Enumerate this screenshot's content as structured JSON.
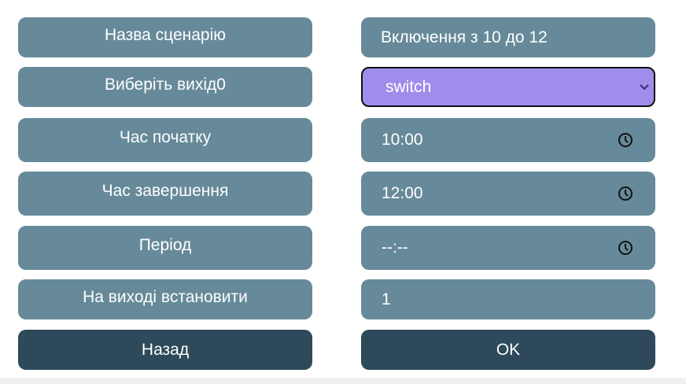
{
  "labels": {
    "scenario_name": "Назва сценарію",
    "select_output": "Виберіть вихід0",
    "start_time": "Час початку",
    "end_time": "Час завершення",
    "period": "Період",
    "set_output": "На виході встановити"
  },
  "fields": {
    "scenario_name_value": "Включення з 10 до 12",
    "output_selected": "switch",
    "start_time_value": "10:00",
    "end_time_value": "12:00",
    "period_value": "--:--",
    "set_output_value": "1"
  },
  "buttons": {
    "back": "Назад",
    "ok": "OK"
  },
  "colors": {
    "field_bg": "#678a9a",
    "button_bg": "#2e4a5a",
    "select_bg": "#a08ceb",
    "text": "#ffffff"
  },
  "icons": {
    "time_picker": "clock-icon",
    "dropdown": "chevron-down-icon"
  }
}
